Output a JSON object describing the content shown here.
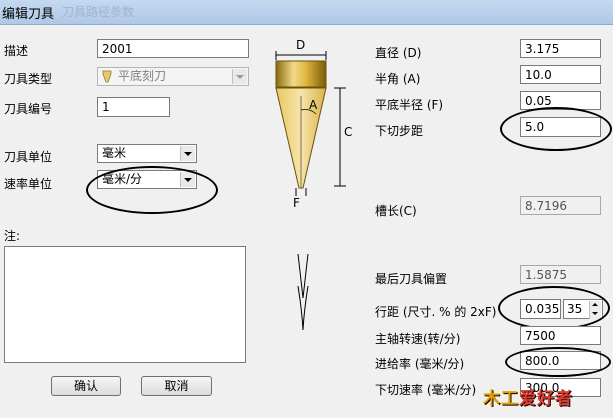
{
  "window": {
    "title": "编辑刀具",
    "ghost_title": "刀具路径参数"
  },
  "left": {
    "description": {
      "label": "描述",
      "value": "2001"
    },
    "tool_type": {
      "label": "刀具类型",
      "value": "平底刻刀"
    },
    "tool_number": {
      "label": "刀具编号",
      "value": "1"
    },
    "tool_unit": {
      "label": "刀具单位",
      "value": "毫米"
    },
    "rate_unit": {
      "label": "速率单位",
      "value": "毫米/分"
    },
    "notes": {
      "label": "注:",
      "value": ""
    }
  },
  "diagram": {
    "d_label": "D",
    "a_label": "A",
    "c_label": "C",
    "f_label": "F"
  },
  "right": {
    "diameter": {
      "label": "直径 (D)",
      "value": "3.175"
    },
    "half_angle": {
      "label": "半角 (A)",
      "value": "10.0"
    },
    "flat_radius": {
      "label": "平底半径 (F)",
      "value": "0.05"
    },
    "stepdown": {
      "label": "下切步距",
      "value": "5.0"
    },
    "flute_length": {
      "label": "槽长(C)",
      "value": "8.7196"
    },
    "last_offset": {
      "label": "最后刀具偏置",
      "value": "1.5875"
    },
    "stepover": {
      "label": "行距 (尺寸. % 的 2xF)",
      "value": "0.035",
      "percent": "35"
    },
    "spindle_speed": {
      "label": "主轴转速(转/分)",
      "value": "7500"
    },
    "feed_rate": {
      "label": "进给率 (毫米/分)",
      "value": "800.0"
    },
    "plunge_rate": {
      "label": "下切速率 (毫米/分)",
      "value": "300.0"
    }
  },
  "buttons": {
    "ok": "确认",
    "cancel": "取消"
  },
  "watermark": {
    "part1": "木工",
    "part2": "爱好者"
  }
}
